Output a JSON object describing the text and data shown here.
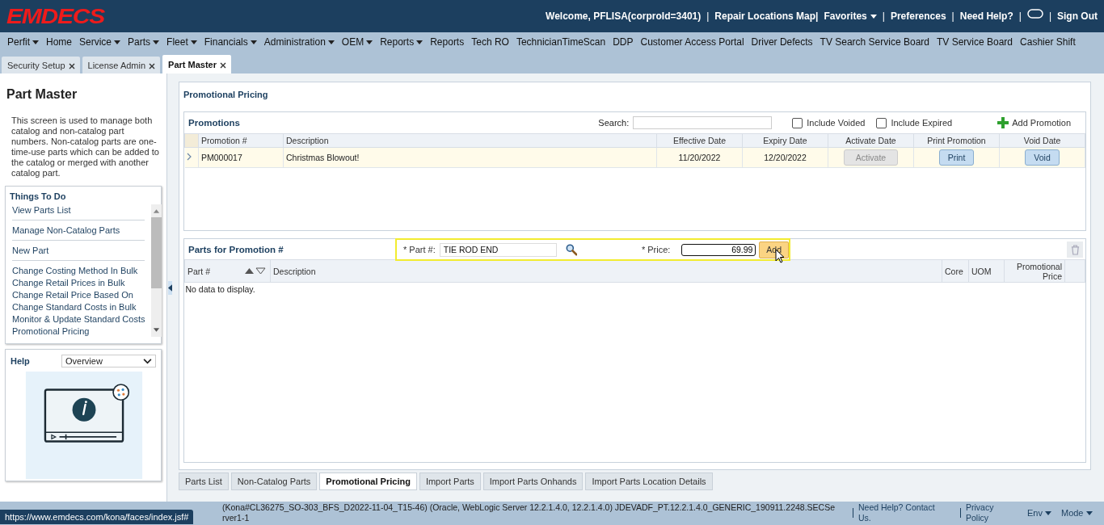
{
  "header": {
    "logo": "EMDECS",
    "items": [
      {
        "kind": "text",
        "label": "Welcome, PFLISA(corproId=3401)"
      },
      {
        "kind": "sep",
        "label": "|"
      },
      {
        "kind": "link",
        "label": "Repair Locations Map|"
      },
      {
        "kind": "dropdown",
        "label": "Favorites"
      },
      {
        "kind": "sep",
        "label": "|"
      },
      {
        "kind": "link",
        "label": "Preferences"
      },
      {
        "kind": "sep",
        "label": "|"
      },
      {
        "kind": "link",
        "label": "Need Help?"
      },
      {
        "kind": "sep",
        "label": "|"
      },
      {
        "kind": "chat"
      },
      {
        "kind": "sep",
        "label": "|"
      },
      {
        "kind": "link",
        "label": "Sign Out"
      }
    ]
  },
  "menu": [
    {
      "label": "Perfit",
      "dropdown": true
    },
    {
      "label": "Home",
      "dropdown": false
    },
    {
      "label": "Service",
      "dropdown": true
    },
    {
      "label": "Parts",
      "dropdown": true
    },
    {
      "label": "Fleet",
      "dropdown": true
    },
    {
      "label": "Financials",
      "dropdown": true
    },
    {
      "label": "Administration",
      "dropdown": true
    },
    {
      "label": "OEM",
      "dropdown": true
    },
    {
      "label": "Reports",
      "dropdown": true
    },
    {
      "label": "Reports",
      "dropdown": false
    },
    {
      "label": "Tech RO",
      "dropdown": false
    },
    {
      "label": "TechnicianTimeScan",
      "dropdown": false
    },
    {
      "label": "DDP",
      "dropdown": false
    },
    {
      "label": "Customer Access Portal",
      "dropdown": false
    },
    {
      "label": "Driver Defects",
      "dropdown": false
    },
    {
      "label": "TV Search Service Board",
      "dropdown": false
    },
    {
      "label": "TV Service Board",
      "dropdown": false
    },
    {
      "label": "Cashier Shift",
      "dropdown": false
    }
  ],
  "doc_tabs": [
    {
      "label": "Security Setup",
      "selected": false
    },
    {
      "label": "License Admin",
      "selected": false
    },
    {
      "label": "Part Master",
      "selected": true
    }
  ],
  "sidebar": {
    "title": "Part Master",
    "description": "This screen is used to manage both catalog and non-catalog part numbers. Non-catalog parts are one-time-use parts which can be added to the catalog or merged with another catalog part.",
    "things_to_do": {
      "title": "Things To Do",
      "items": [
        {
          "label": "View Parts List",
          "separated": true
        },
        {
          "label": "Manage Non-Catalog Parts",
          "separated": true
        },
        {
          "label": "New Part",
          "separated": true
        },
        {
          "label": "Change Costing Method In Bulk",
          "separated": false
        },
        {
          "label": "Change Retail Prices in Bulk",
          "separated": false
        },
        {
          "label": "Change Retail Price Based On",
          "separated": false
        },
        {
          "label": "Change Standard Costs in Bulk",
          "separated": false
        },
        {
          "label": "Monitor & Update Standard Costs",
          "separated": false
        },
        {
          "label": "Promotional Pricing",
          "separated": false
        }
      ]
    },
    "help": {
      "title": "Help",
      "topic": "Overview"
    }
  },
  "main": {
    "title": "Promotional Pricing",
    "promotions": {
      "title": "Promotions",
      "search_label": "Search:",
      "filters": [
        {
          "label": "Include Voided",
          "checked": false
        },
        {
          "label": "Include Expired",
          "checked": false
        }
      ],
      "add_label": "Add Promotion",
      "columns": [
        "Promotion #",
        "Description",
        "Effective Date",
        "Expiry Date",
        "Activate Date",
        "Print Promotion",
        "Void Date"
      ],
      "rows": [
        {
          "selected": true,
          "number": "PM000017",
          "description": "Christmas Blowout!",
          "effective": "11/20/2022",
          "expiry": "12/20/2022",
          "activate": {
            "label": "Activate",
            "disabled": true
          },
          "print": {
            "label": "Print",
            "disabled": false
          },
          "void": {
            "label": "Void",
            "disabled": false
          }
        }
      ]
    },
    "parts": {
      "title": "Parts for Promotion #",
      "part_label": "* Part #:",
      "part_value": "TIE ROD END",
      "price_label": "* Price:",
      "price_value": "69.99",
      "add_label": "Add",
      "columns": [
        "Part #",
        "Description",
        "Core",
        "UOM",
        "Promotional Price"
      ],
      "empty": "No data to display."
    }
  },
  "bottom_tabs": [
    {
      "label": "Parts List",
      "selected": false
    },
    {
      "label": "Non-Catalog Parts",
      "selected": false
    },
    {
      "label": "Promotional Pricing",
      "selected": true
    },
    {
      "label": "Import Parts",
      "selected": false
    },
    {
      "label": "Import Parts Onhands",
      "selected": false
    },
    {
      "label": "Import Parts Location Details",
      "selected": false
    }
  ],
  "footer": {
    "version": "(Kona#CL36275_SO-303_BFS_D2022-11-04_T15-46) (Oracle, WebLogic Server 12.2.1.4.0, 12.2.1.4.0) JDEVADF_PT.12.2.1.4.0_GENERIC_190911.2248.SECServer1-1",
    "links": [
      "Need Help? Contact Us.",
      "Privacy Policy"
    ],
    "menus": [
      "Env",
      "Mode"
    ],
    "url": "https://www.emdecs.com/kona/faces/index.jsf#"
  }
}
